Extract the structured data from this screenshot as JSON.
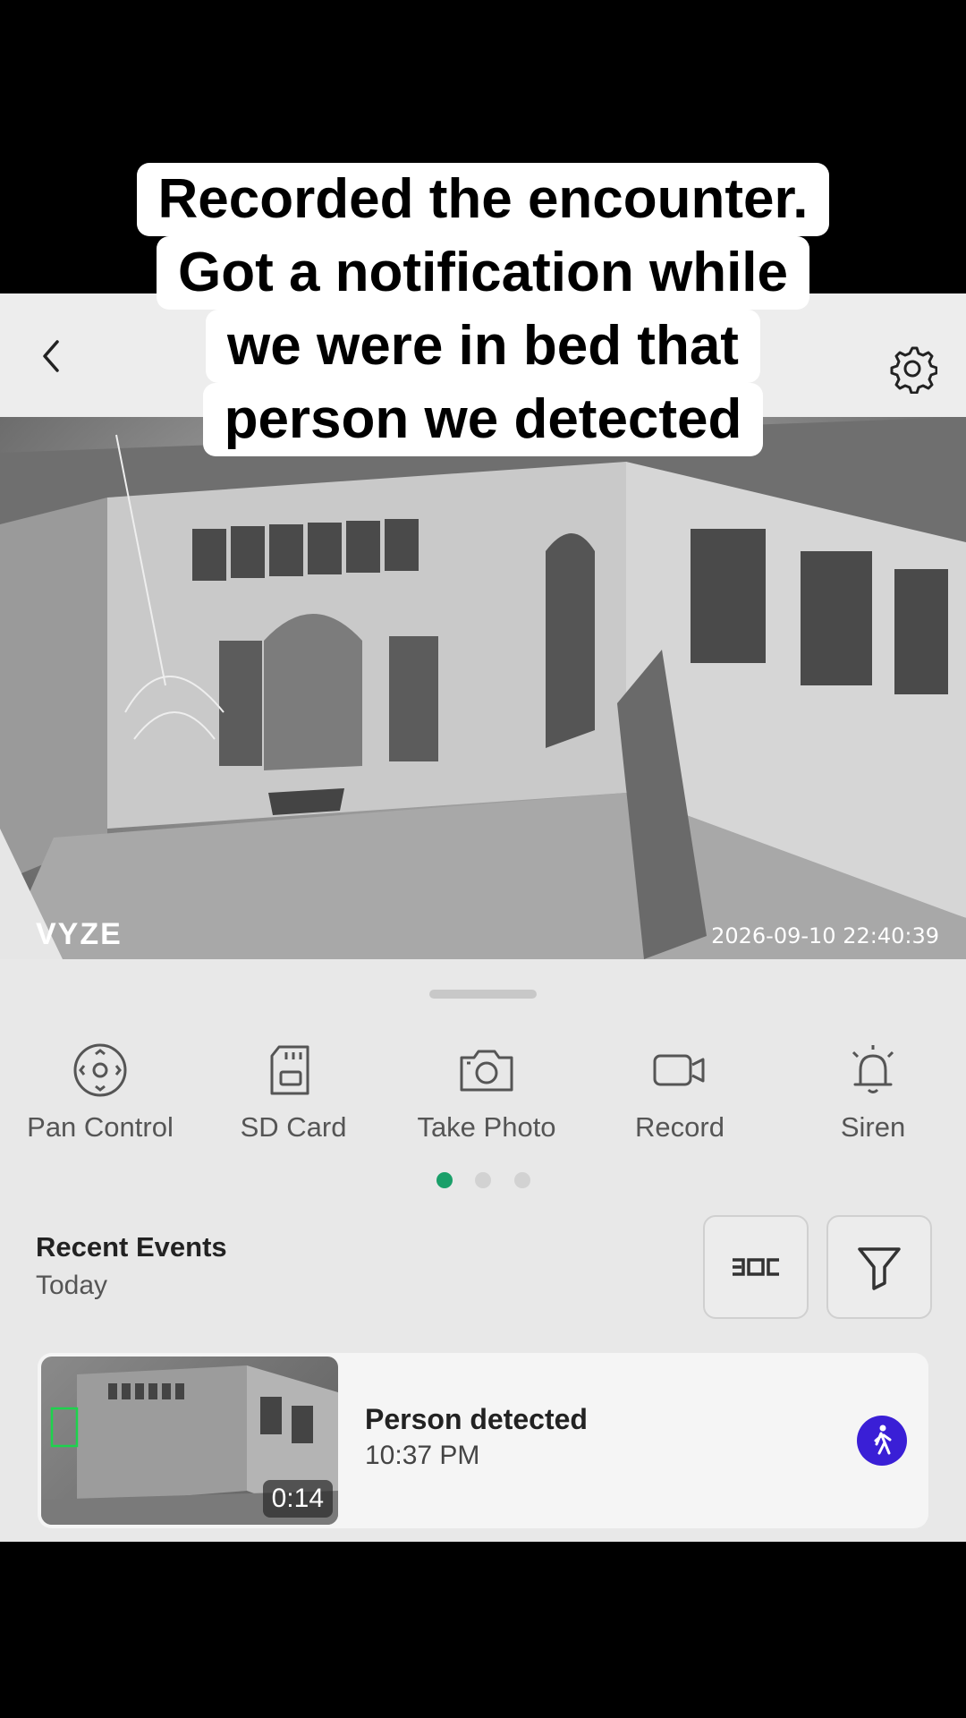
{
  "caption": {
    "lines": [
      "Recorded the encounter.",
      "Got a notification while",
      "we were in bed that",
      "person we detected"
    ]
  },
  "topbar": {
    "back_icon": "chevron-left-icon",
    "settings_icon": "gear-icon"
  },
  "camera": {
    "watermark": "VYZE",
    "timestamp": "2026-09-10  22:40:39"
  },
  "actions": [
    {
      "label": "Pan Control",
      "icon": "pan-control-icon"
    },
    {
      "label": "SD Card",
      "icon": "sd-card-icon"
    },
    {
      "label": "Take Photo",
      "icon": "camera-icon"
    },
    {
      "label": "Record",
      "icon": "video-camera-icon"
    },
    {
      "label": "Siren",
      "icon": "siren-icon"
    }
  ],
  "pager": {
    "pages": 3,
    "active": 1
  },
  "recent": {
    "title": "Recent Events",
    "subtitle": "Today"
  },
  "events": [
    {
      "title": "Person detected",
      "time": "10:37 PM",
      "duration": "0:14",
      "icon": "person-walking-icon"
    }
  ],
  "colors": {
    "accent": "#1a9f69",
    "event_icon_bg": "#3a1fd6"
  }
}
